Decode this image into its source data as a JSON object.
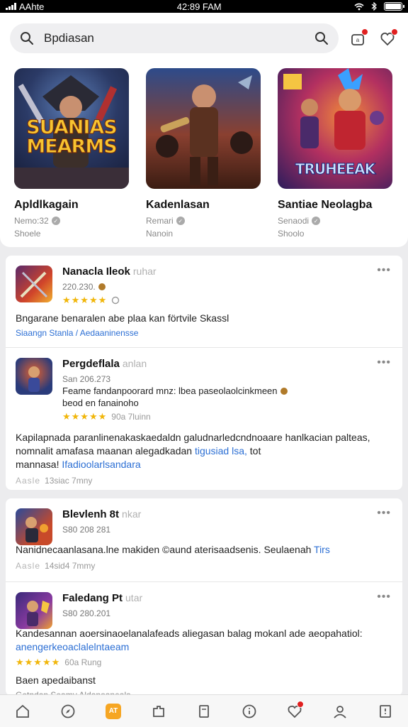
{
  "status": {
    "carrier": "AAhte",
    "time": "42:89 FAM"
  },
  "search": {
    "value": "Bpdiasan"
  },
  "featured": [
    {
      "title": "Apldlkagain",
      "meta": "Nemo:32",
      "sub": "Shoele",
      "art_text": "SUANIAS MEARMS"
    },
    {
      "title": "Kadenlasan",
      "meta": "Remari",
      "sub": "Nanoin",
      "art_text": ""
    },
    {
      "title": "Santiae Neolagba",
      "meta": "Senaodi",
      "sub": "Shoolo",
      "art_text": "TRUHEEAK"
    }
  ],
  "feed": [
    {
      "title": "Nanacla Ileok",
      "title_faint": "ruhar",
      "date": "220.230.",
      "rating": "★★★★★",
      "rating_meta": "",
      "text": "Bngarane benaralen abe plaa kan förtvile Skassl",
      "text_link": "",
      "tags": "Siaangn Stanla / Aedaaninensse"
    },
    {
      "title": "Pergdeflala",
      "title_faint": "anlan",
      "date": "San 206.273",
      "subtext": "Feame fandanpoorard mnz: lbea paseolaolcinkmeen",
      "subtext2": "beod en fanainoho",
      "rating": "★★★★★",
      "rating_meta": "90a 7luinn",
      "text": "Kapilapnada paranlinenakaskaedaldn galudnarledcndnoaare hanlkacian palteas, nomnalit amafasa maanan alegadkadan",
      "text_link": "tigusiad lsa,",
      "text_tail": "tot",
      "text2": "mannasa!",
      "text2_link": "Ifadioolarlsandara",
      "footer_rating": "Aasle",
      "footer_meta": "13siac 7mny"
    },
    {
      "title": "Blevlenh 8t",
      "title_faint": "nkar",
      "date": "S80 208 281",
      "text": "Nanidnecaanlasana.lne makiden ©aund aterisaadsenis. Seulaenah",
      "text_link": "Tirs",
      "footer_rating": "Aasle",
      "footer_meta": "14sid4 7mmy"
    },
    {
      "title": "Faledang Pt",
      "title_faint": "utar",
      "date": "S80 280.201",
      "text": "Kandesannan aoersinaoelanalafeads aliegasan balag mokanl ade aeopahatiol:",
      "text_link": "anengerkeoaclalelntaeam",
      "rating": "★★★★★",
      "rating_meta": "60a Rung",
      "text2": "Baen apedaibanst",
      "tags": "Getndan Seamy Aldanoaneala"
    }
  ],
  "tabs": [
    "home-icon",
    "compass-icon",
    "games-icon",
    "puzzle-icon",
    "book-icon",
    "info-icon",
    "heart-icon",
    "profile-icon",
    "menu-icon"
  ],
  "active_tab_label": "AT",
  "colors": {
    "accent": "#f6a623",
    "link": "#2c6fd4",
    "star": "#f1b60a",
    "badge": "#e02020"
  }
}
